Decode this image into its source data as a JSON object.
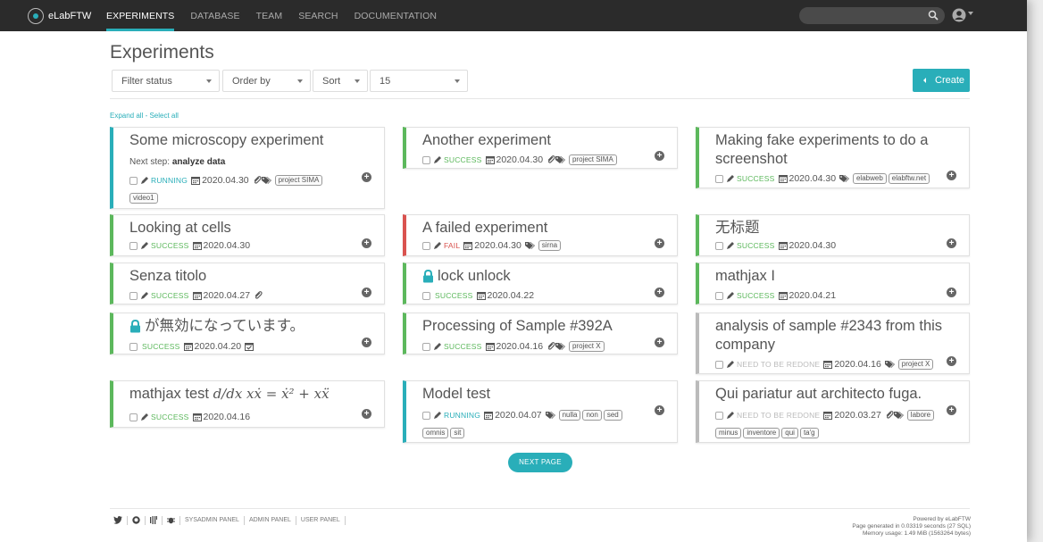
{
  "app": {
    "brand": "eLabFTW"
  },
  "nav": {
    "items": [
      "EXPERIMENTS",
      "DATABASE",
      "TEAM",
      "SEARCH",
      "DOCUMENTATION"
    ]
  },
  "page": {
    "title": "Experiments"
  },
  "filters": {
    "status": "Filter status",
    "order": "Order by",
    "sort": "Sort",
    "limit": "15"
  },
  "create_label": "Create",
  "expand_links": "Expand all - Select all",
  "colors": {
    "accent": "#29aeb9",
    "success": "#5cb85c",
    "running": "#29aeb9",
    "fail": "#d9534f",
    "redo": "#bbbbbb"
  },
  "experiments": [
    {
      "title": "Some microscopy experiment",
      "nextstep_label": "Next step:",
      "nextstep": "analyze data",
      "status": "RUNNING",
      "date": "2020.04.30",
      "tags": [
        "project SIMA",
        "video1"
      ]
    },
    {
      "title": "Another experiment",
      "status": "SUCCESS",
      "date": "2020.04.30",
      "tags": [
        "project SIMA"
      ]
    },
    {
      "title": "Making fake experiments to do a screenshot",
      "status": "SUCCESS",
      "date": "2020.04.30",
      "tags": [
        "elabweb",
        "elabftw.net"
      ]
    },
    {
      "title": "Looking at cells",
      "status": "SUCCESS",
      "date": "2020.04.30",
      "tags": []
    },
    {
      "title": "A failed experiment",
      "status": "FAIL",
      "date": "2020.04.30",
      "tags": [
        "sirna"
      ]
    },
    {
      "title": "无标题",
      "status": "SUCCESS",
      "date": "2020.04.30",
      "tags": []
    },
    {
      "title": "Senza titolo",
      "status": "SUCCESS",
      "date": "2020.04.27",
      "tags": []
    },
    {
      "title": "lock unlock",
      "status": "SUCCESS",
      "date": "2020.04.22",
      "tags": []
    },
    {
      "title": "mathjax I",
      "status": "SUCCESS",
      "date": "2020.04.21",
      "tags": []
    },
    {
      "title": "が無効になっています。",
      "status": "SUCCESS",
      "date": "2020.04.20",
      "tags": []
    },
    {
      "title": "Processing of Sample #392A",
      "status": "SUCCESS",
      "date": "2020.04.16",
      "tags": [
        "project X"
      ]
    },
    {
      "title": "analysis of sample #2343 from this company",
      "status": "NEED TO BE REDONE",
      "date": "2020.04.16",
      "tags": [
        "project X"
      ]
    },
    {
      "title": "mathjax test",
      "formula": "d/dx xẋ = ẋ² + xẍ",
      "status": "SUCCESS",
      "date": "2020.04.16",
      "tags": []
    },
    {
      "title": "Model test",
      "status": "RUNNING",
      "date": "2020.04.07",
      "tags": [
        "nulla",
        "non",
        "sed",
        "omnis",
        "sit"
      ]
    },
    {
      "title": "Qui pariatur aut architecto fuga.",
      "status": "NEED TO BE REDONE",
      "date": "2020.03.27",
      "tags": [
        "labore",
        "minus",
        "inventore",
        "qui",
        "ta'g"
      ]
    }
  ],
  "next_page": "NEXT PAGE",
  "footer": {
    "links": [
      "SYSADMIN PANEL",
      "ADMIN PANEL",
      "USER PANEL"
    ],
    "powered": "Powered by eLabFTW",
    "generated": "Page generated in 0.03319 seconds (27 SQL)",
    "memory": "Memory usage: 1.49 MiB (1563264 bytes)"
  }
}
